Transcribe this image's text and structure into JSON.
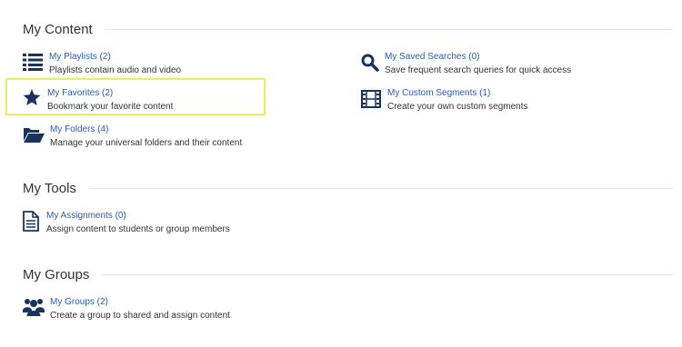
{
  "sections": {
    "content": {
      "title": "My Content",
      "items": {
        "playlists": {
          "label": "My Playlists (2)",
          "desc": "Playlists contain audio and video",
          "icon": "list-icon"
        },
        "favorites": {
          "label": "My Favorites (2)",
          "desc": "Bookmark your favorite content",
          "icon": "star-icon"
        },
        "folders": {
          "label": "My Folders (4)",
          "desc": "Manage your universal folders and their content",
          "icon": "folder-open-icon"
        },
        "saved_searches": {
          "label": "My Saved Searches (0)",
          "desc": "Save frequent search queries for quick access",
          "icon": "search-icon"
        },
        "custom_segments": {
          "label": "My Custom Segments (1)",
          "desc": "Create your own custom segments",
          "icon": "film-icon"
        }
      }
    },
    "tools": {
      "title": "My Tools",
      "items": {
        "assignments": {
          "label": "My Assignments (0)",
          "desc": "Assign content to students or group members",
          "icon": "document-icon"
        }
      }
    },
    "groups": {
      "title": "My Groups",
      "items": {
        "groups": {
          "label": "My Groups (2)",
          "desc": "Create a group to shared and assign content",
          "icon": "users-icon"
        }
      }
    }
  },
  "colors": {
    "link": "#2a5db0",
    "icon": "#17345e",
    "highlight": "#e9ee6a",
    "rule": "#e6e6e6"
  }
}
